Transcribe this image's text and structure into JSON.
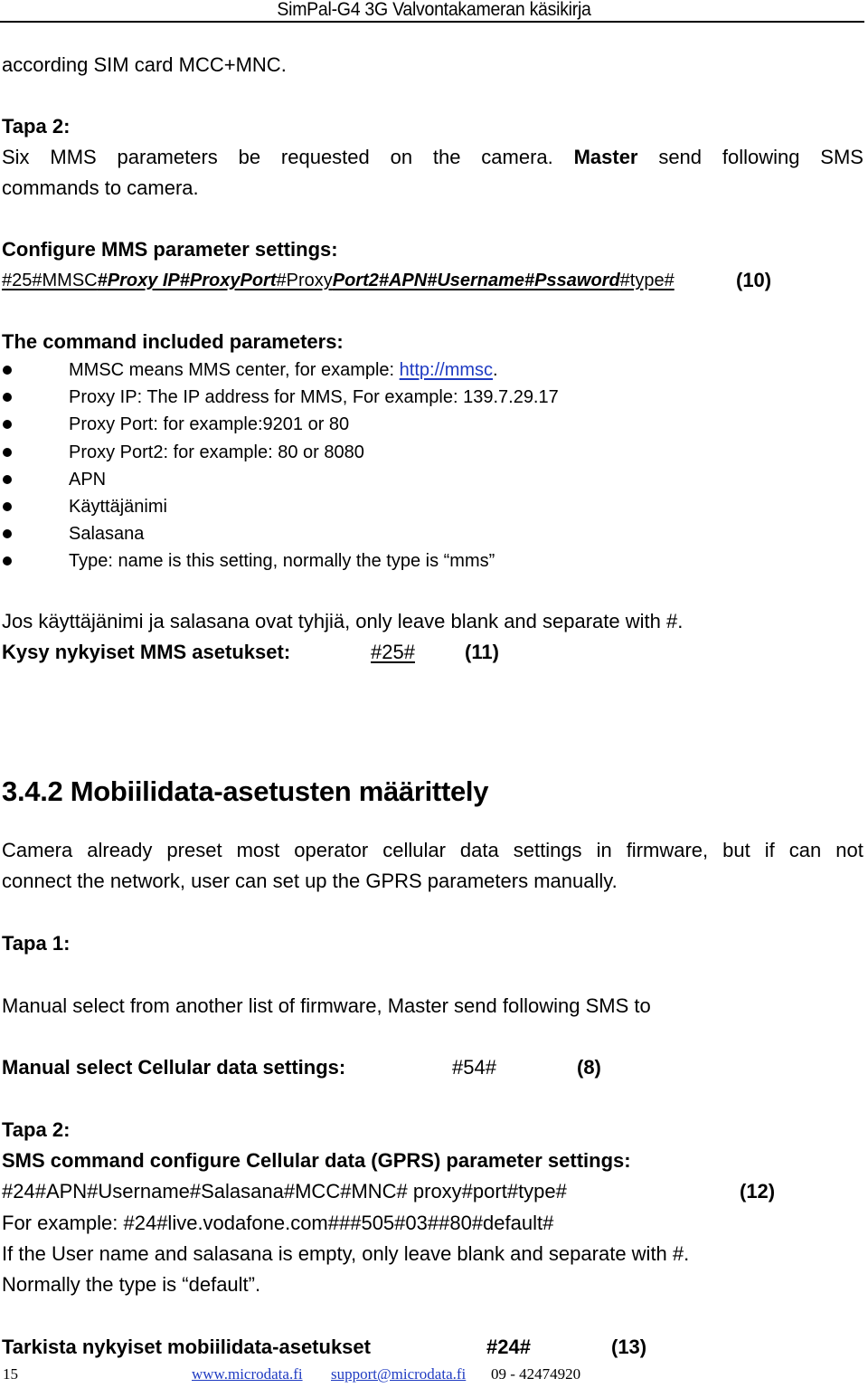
{
  "header": {
    "title": "SimPal-G4 3G Valvontakameran käsikirja"
  },
  "intro": {
    "continuation": "according SIM card MCC+MNC."
  },
  "tapa2_mms": {
    "label": "Tapa 2:",
    "line1_words": [
      "Six",
      "MMS",
      "parameters",
      "be",
      "requested",
      "on",
      "the",
      "camera.",
      "Master",
      "send",
      "following",
      "SMS"
    ],
    "line1_bold_word": "Master",
    "line2": "commands to camera."
  },
  "configure_mms": {
    "heading": "Configure MMS parameter settings:",
    "command_segments": [
      {
        "text": "#25#MMSC",
        "style": "regular"
      },
      {
        "text": "#Proxy IP#ProxyPort",
        "style": "bold-italic"
      },
      {
        "text": "#Proxy",
        "style": "regular"
      },
      {
        "text": "Port2#APN#Username#Pssaword",
        "style": "bold-italic"
      },
      {
        "text": "#type#",
        "style": "regular"
      }
    ],
    "command_number": "(10)"
  },
  "parameters": {
    "heading": "The command included parameters:",
    "items": [
      {
        "text": "MMSC means MMS center, for example: ",
        "link": "http://mmsc",
        "suffix": "."
      },
      {
        "text": "Proxy IP: The IP address for MMS, For example: 139.7.29.17"
      },
      {
        "text": "Proxy Port: for example:9201 or 80"
      },
      {
        "text": "Proxy Port2: for example: 80 or 8080"
      },
      {
        "text": "APN"
      },
      {
        "text": "Käyttäjänimi"
      },
      {
        "text": "Salasana"
      },
      {
        "text": "Type: name is this setting, normally the type is “mms”"
      }
    ]
  },
  "blank_note": "Jos käyttäjänimi ja salasana ovat tyhjiä, only leave blank and separate with #.",
  "query_mms": {
    "label": "Kysy nykyiset MMS asetukset:",
    "command": "#25#",
    "number": "(11)"
  },
  "section": {
    "heading": "3.4.2 Mobiilidata-asetusten määrittely",
    "paragraph_line1": "Camera already preset most operator cellular data settings in firmware, but if can not",
    "paragraph_line2": "connect the network, user can set up the GPRS parameters manually."
  },
  "tapa1": {
    "label": "Tapa 1:",
    "text": "Manual select from another list of firmware, Master send following SMS to",
    "command_label": "Manual select Cellular data settings:",
    "command": "#54#",
    "number": "(8)"
  },
  "tapa2_gprs": {
    "label": "Tapa 2:",
    "heading": "SMS command configure Cellular data (GPRS) parameter settings:",
    "command": "#24#APN#Username#Salasana#MCC#MNC# proxy#port#type#",
    "number": "(12)",
    "example": "For example: #24#live.vodafone.com###505#03##80#default#",
    "note1": "If the User name and salasana is empty, only leave blank and separate with #.",
    "note2": "Normally the type is “default”."
  },
  "check_data": {
    "label": "Tarkista nykyiset mobiilidata-asetukset",
    "command": "#24#",
    "number": "(13)"
  },
  "footer": {
    "page_number": "15",
    "website": "www.microdata.fi",
    "email": "support@microdata.fi",
    "phone": "09 - 42474920"
  },
  "colors": {
    "link": "#1f3bc2",
    "text": "#000000",
    "background": "#ffffff"
  }
}
